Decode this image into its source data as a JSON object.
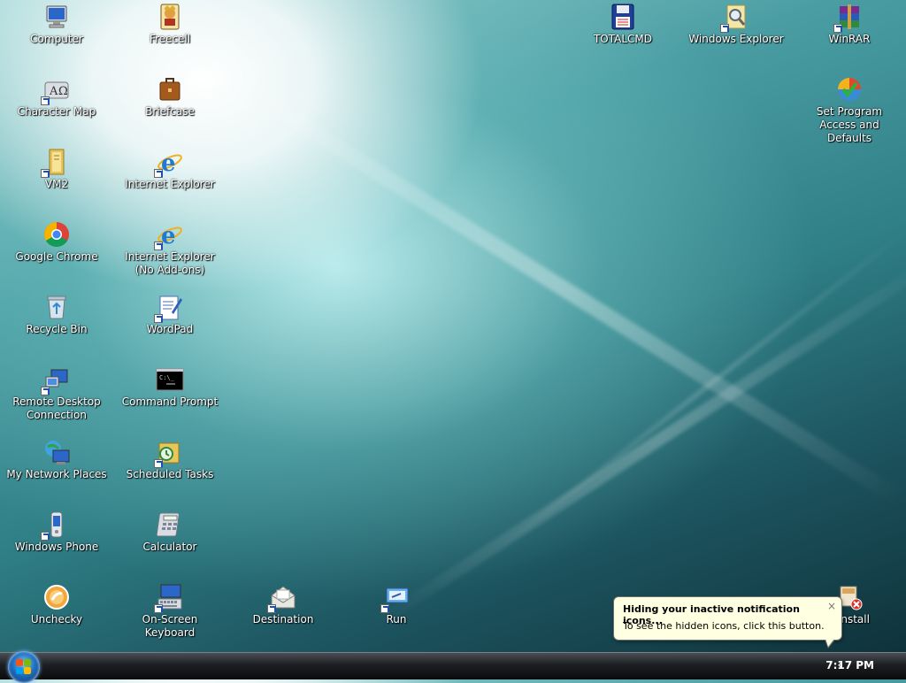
{
  "desktop": {
    "icons": [
      {
        "label": "Computer",
        "icon": "computer-icon"
      },
      {
        "label": "Freecell",
        "icon": "freecell-icon"
      },
      {
        "label": "TOTALCMD",
        "icon": "totalcmd-icon"
      },
      {
        "label": "Windows Explorer",
        "icon": "windows-explorer-icon"
      },
      {
        "label": "WinRAR",
        "icon": "winrar-icon"
      },
      {
        "label": "Character Map",
        "icon": "character-map-icon"
      },
      {
        "label": "Briefcase",
        "icon": "briefcase-icon"
      },
      {
        "label": "Set Program Access and Defaults",
        "icon": "program-access-icon"
      },
      {
        "label": "VM2",
        "icon": "folder-icon"
      },
      {
        "label": "Internet Explorer",
        "icon": "internet-explorer-icon"
      },
      {
        "label": "Google Chrome",
        "icon": "chrome-icon"
      },
      {
        "label": "Internet Explorer (No Add-ons)",
        "icon": "internet-explorer-icon"
      },
      {
        "label": "Recycle Bin",
        "icon": "recycle-bin-icon"
      },
      {
        "label": "WordPad",
        "icon": "wordpad-icon"
      },
      {
        "label": "Remote Desktop Connection",
        "icon": "remote-desktop-icon"
      },
      {
        "label": "Command Prompt",
        "icon": "command-prompt-icon"
      },
      {
        "label": "My Network Places",
        "icon": "network-places-icon"
      },
      {
        "label": "Scheduled Tasks",
        "icon": "scheduled-tasks-icon"
      },
      {
        "label": "Windows Phone",
        "icon": "phone-icon"
      },
      {
        "label": "Calculator",
        "icon": "calculator-icon"
      },
      {
        "label": "Unchecky",
        "icon": "unchecky-icon"
      },
      {
        "label": "On-Screen Keyboard",
        "icon": "keyboard-icon"
      },
      {
        "label": "Destination",
        "icon": "destination-icon"
      },
      {
        "label": "Run",
        "icon": "run-icon"
      },
      {
        "label": "install",
        "icon": "uninstall-icon"
      }
    ]
  },
  "notification": {
    "title": "Hiding your inactive notification icons...",
    "body": "To see the hidden icons, click this button.",
    "close": "×"
  },
  "taskbar": {
    "show_hidden": "‹",
    "clock": "7:17 PM"
  },
  "colors": {
    "balloon_bg": "#ffffe1",
    "taskbar": "#1c1f22"
  }
}
